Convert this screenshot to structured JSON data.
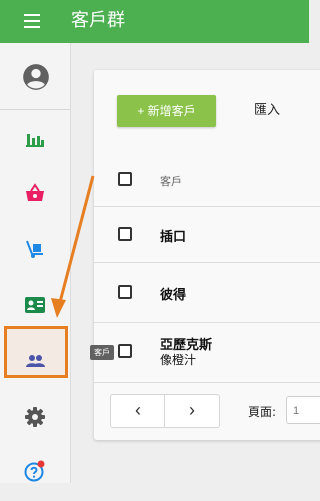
{
  "app": {
    "title": "客戶群"
  },
  "sidebar": {
    "tooltip": "客戶",
    "items": [
      {
        "icon": "account-circle-icon"
      },
      {
        "icon": "bar-chart-icon"
      },
      {
        "icon": "shopping-basket-icon"
      },
      {
        "icon": "hand-truck-icon"
      },
      {
        "icon": "contact-card-icon"
      },
      {
        "icon": "people-icon",
        "active": true
      },
      {
        "icon": "gear-icon"
      },
      {
        "icon": "help-icon"
      }
    ]
  },
  "toolbar": {
    "add_label": "+ 新增客戶",
    "import_label": "匯入"
  },
  "table": {
    "header": "客戶",
    "rows": [
      {
        "name": "插口",
        "sub": ""
      },
      {
        "name": "彼得",
        "sub": ""
      },
      {
        "name": "亞歷克斯",
        "sub": "像橙汁"
      }
    ]
  },
  "pagination": {
    "prev": "‹",
    "next": "›",
    "page_label": "頁面:",
    "page_value": "1"
  },
  "colors": {
    "primary": "#4caf50",
    "accent": "#8bc34a",
    "highlight": "#e67e22"
  }
}
